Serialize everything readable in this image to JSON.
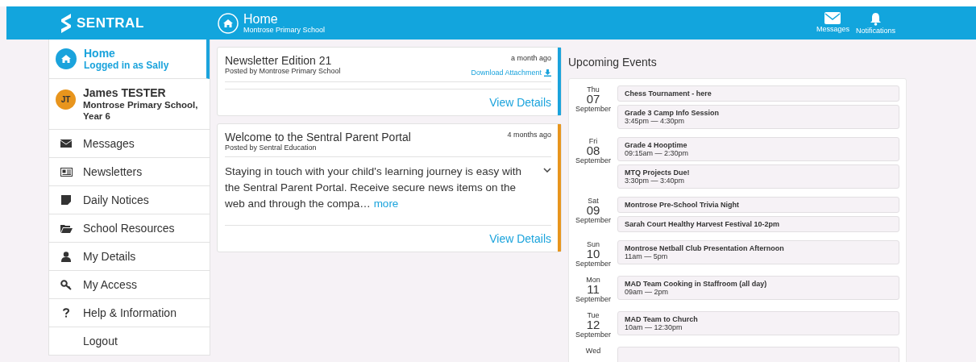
{
  "header": {
    "logo": "SENTRAL",
    "page_title": "Home",
    "school": "Montrose Primary School",
    "actions": [
      {
        "kind": "messages",
        "label": "Messages"
      },
      {
        "kind": "notifications",
        "label": "Notifications"
      }
    ]
  },
  "sidebar": {
    "home": {
      "title": "Home",
      "subtitle": "Logged in as Sally",
      "selected": true
    },
    "student": {
      "initials": "JT",
      "name": "James TESTER",
      "details": "Montrose Primary School, Year 6"
    },
    "items": [
      {
        "kind": "messages",
        "label": "Messages",
        "selected": false
      },
      {
        "kind": "newsletters",
        "label": "Newsletters",
        "selected": false
      },
      {
        "kind": "notices",
        "label": "Daily Notices",
        "selected": false
      },
      {
        "kind": "resources",
        "label": "School Resources",
        "selected": false
      },
      {
        "kind": "details",
        "label": "My Details",
        "selected": false
      },
      {
        "kind": "access",
        "label": "My Access",
        "selected": false
      },
      {
        "kind": "help",
        "label": "Help & Information",
        "selected": false
      },
      {
        "kind": "logout",
        "label": "Logout",
        "selected": false
      }
    ]
  },
  "posts": [
    {
      "title": "Newsletter Edition 21",
      "posted_by": "Posted by Montrose Primary School",
      "time": "a month ago",
      "attachment": "Download Attachment",
      "color": "#1aa3dc",
      "action": "View Details"
    },
    {
      "title": "Welcome to the Sentral Parent Portal",
      "posted_by": "Posted by Sentral Education",
      "time": "4 months ago",
      "body": "Staying in touch with your child's learning journey is easy with the Sentral Parent Portal. Receive secure news items on the web and through the compa…",
      "more": "more",
      "expanded": false,
      "color": "#e8951d",
      "action": "View Details"
    }
  ],
  "events": {
    "title": "Upcoming Events",
    "days": [
      {
        "weekday": "Thu",
        "day": "07",
        "month": "September",
        "items": [
          {
            "title": "Chess Tournament - here"
          },
          {
            "title": "Grade 3 Camp Info Session",
            "time": "3:45pm — 4:30pm"
          }
        ]
      },
      {
        "weekday": "Fri",
        "day": "08",
        "month": "September",
        "items": [
          {
            "title": "Grade 4 Hooptime",
            "time": "09:15am — 2:30pm"
          },
          {
            "title": "MTQ Projects Due!",
            "time": "3:30pm — 3:40pm"
          }
        ]
      },
      {
        "weekday": "Sat",
        "day": "09",
        "month": "September",
        "items": [
          {
            "title": "Montrose Pre-School Trivia Night"
          },
          {
            "title": "Sarah Court Healthy Harvest Festival 10-2pm"
          }
        ]
      },
      {
        "weekday": "Sun",
        "day": "10",
        "month": "September",
        "items": [
          {
            "title": "Montrose Netball Club Presentation Afternoon",
            "time": "11am — 5pm"
          }
        ]
      },
      {
        "weekday": "Mon",
        "day": "11",
        "month": "September",
        "items": [
          {
            "title": "MAD Team Cooking in Staffroom (all day)",
            "time": "09am — 2pm"
          }
        ]
      },
      {
        "weekday": "Tue",
        "day": "12",
        "month": "September",
        "items": [
          {
            "title": "MAD Team to Church",
            "time": "10am — 12:30pm"
          }
        ]
      },
      {
        "weekday": "Wed"
      }
    ]
  }
}
